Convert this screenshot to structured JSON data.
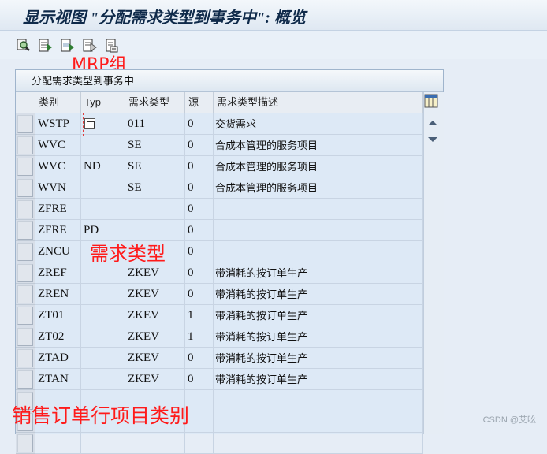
{
  "window": {
    "title": "显示视图 \"分配需求类型到事务中\": 概览"
  },
  "toolbar": {
    "buttons": [
      {
        "name": "details-button",
        "icon": "magnifier-icon"
      },
      {
        "name": "select-all-button",
        "icon": "select-all-icon"
      },
      {
        "name": "select-block-button",
        "icon": "select-block-icon"
      },
      {
        "name": "deselect-all-button",
        "icon": "deselect-icon"
      },
      {
        "name": "print-button",
        "icon": "print-icon"
      }
    ]
  },
  "annotations": {
    "mrp_group": "MRP组",
    "req_type": "需求类型",
    "item_category": "销售订单行项目类别"
  },
  "table": {
    "title": "分配需求类型到事务中",
    "columns": [
      "类别",
      "Typ",
      "需求类型",
      "源",
      "需求类型描述"
    ],
    "rows": [
      [
        "WSTP",
        "",
        "011",
        "0",
        "交货需求"
      ],
      [
        "WVC",
        "",
        "SE",
        "0",
        "合成本管理的服务项目"
      ],
      [
        "WVC",
        "ND",
        "SE",
        "0",
        "合成本管理的服务项目"
      ],
      [
        "WVN",
        "",
        "SE",
        "0",
        "合成本管理的服务项目"
      ],
      [
        "ZFRE",
        "",
        "",
        "0",
        ""
      ],
      [
        "ZFRE",
        "PD",
        "",
        "0",
        ""
      ],
      [
        "ZNCU",
        "",
        "",
        "0",
        ""
      ],
      [
        "ZREF",
        "",
        "ZKEV",
        "0",
        "带消耗的按订单生产"
      ],
      [
        "ZREN",
        "",
        "ZKEV",
        "0",
        "带消耗的按订单生产"
      ],
      [
        "ZT01",
        "",
        "ZKEV",
        "1",
        "带消耗的按订单生产"
      ],
      [
        "ZT02",
        "",
        "ZKEV",
        "1",
        "带消耗的按订单生产"
      ],
      [
        "ZTAD",
        "",
        "ZKEV",
        "0",
        "带消耗的按订单生产"
      ],
      [
        "ZTAN",
        "",
        "ZKEV",
        "0",
        "带消耗的按订单生产"
      ],
      [
        "",
        "",
        "",
        "",
        ""
      ],
      [
        "",
        "",
        "",
        "",
        ""
      ],
      [
        "",
        "",
        "",
        "",
        ""
      ]
    ]
  },
  "watermark": "CSDN @艾吆",
  "colors": {
    "accent": "#0f2a4a",
    "annotation": "#ff1a1a",
    "grid_bg": "#dde9f6"
  }
}
